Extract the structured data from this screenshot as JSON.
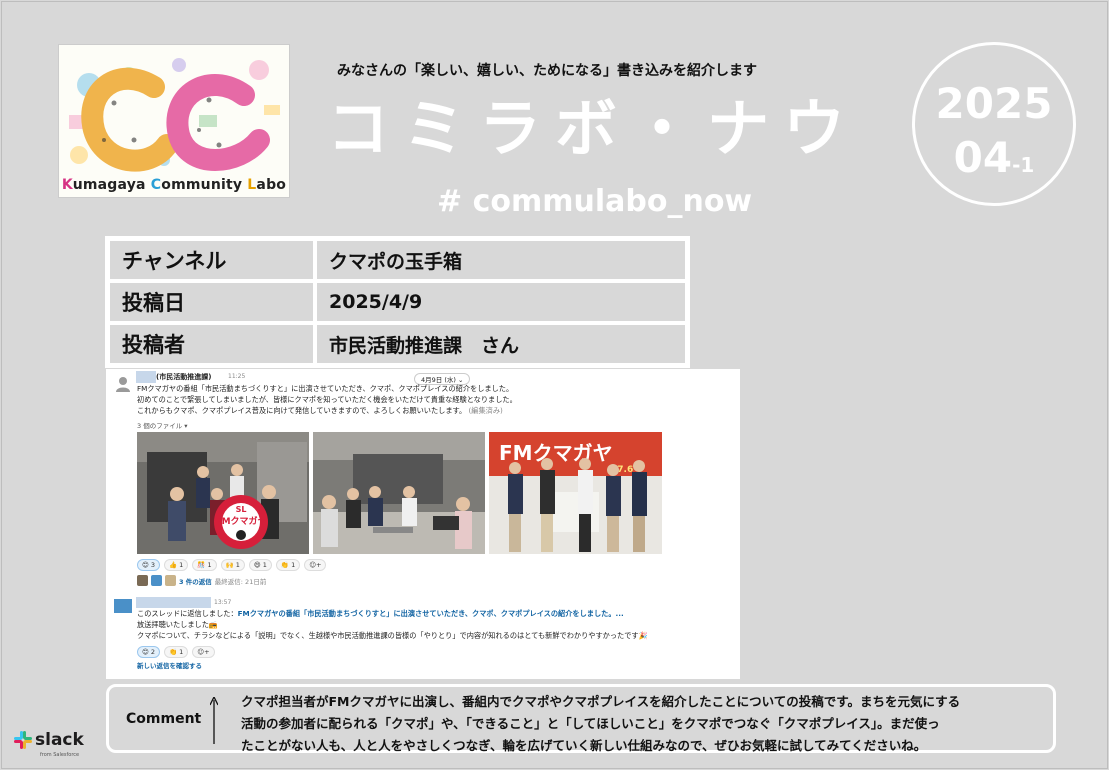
{
  "logo": {
    "text_k": "K",
    "text_1": "umagaya ",
    "text_c": "C",
    "text_2": "ommunity ",
    "text_l": "L",
    "text_3": "abo"
  },
  "header": {
    "tagline": "みなさんの「楽しい、嬉しい、ためになる」書き込みを紹介します",
    "title": "コミラボ・ナウ",
    "hashtag": "# commulabo_now"
  },
  "date_badge": {
    "year": "2025",
    "issue": "04",
    "issue_sub": "-1"
  },
  "info": [
    {
      "key": "チャンネル",
      "value": "クマポの玉手箱"
    },
    {
      "key": "投稿日",
      "value": "2025/4/9"
    },
    {
      "key": "投稿者",
      "value": "市民活動推進課　さん"
    }
  ],
  "post": {
    "poster": "(市民活動推進課)",
    "time": "11:25",
    "day_pill": "4月9日 (水) ⌄",
    "lines": [
      "FMクマガヤの番組「市民活動まちづくりすと」に出演させていただき、クマポ、クマポプレイスの紹介をしました。",
      "初めてのことで緊張してしまいましたが、皆様にクマポを知っていただく機会をいただけて貴重な経験となりました。",
      "これからもクマポ、クマポプレイス普及に向けて発信していきますので、よろしくお願いいたします。"
    ],
    "edited": "(編集済み)",
    "files": "3 個のファイル ▾",
    "photo_labels": [
      "SL",
      "FMクマガヤ",
      "FMクマガヤ",
      "87.6"
    ],
    "reactions": [
      "3",
      "1",
      "1",
      "1",
      "1",
      "1"
    ],
    "replies_count": "3 件の返信",
    "replies_meta": "最終返信: 21日前"
  },
  "thread": {
    "time": "13:57",
    "reply_prefix": "このスレッドに返信しました：",
    "reply_link": "FMクマガヤの番組「市民活動まちづくりすと」に出演させていただき、クマポ、クマポプレイスの紹介をしました。...",
    "line2": "放送拝聴いたしました📻",
    "line3": "クマポについて、チラシなどによる「説明」でなく、生越様や市民活動推進課の皆様の「やりとり」で内容が知れるのはとても新鮮でわかりやすかったです🎉",
    "reactions": [
      "2",
      "1"
    ],
    "new_reply": "新しい返信を確認する"
  },
  "comment": {
    "label": "Comment",
    "lines": [
      "クマポ担当者がFMクマガヤに出演し、番組内でクマポやクマポプレイスを紹介したことについての投稿です。まちを元気にする",
      "活動の参加者に配られる「クマポ」や、「できること」と「してほしいこと」をクマポでつなぐ「クマポプレイス」。まだ使っ",
      "たことがない人も、人と人をやさしくつなぎ、輪を広げていく新しい仕組みなので、ぜひお気軽に試してみてくださいね。"
    ]
  },
  "footer": {
    "slack": "slack",
    "slack_sub": "from Salesforce"
  }
}
